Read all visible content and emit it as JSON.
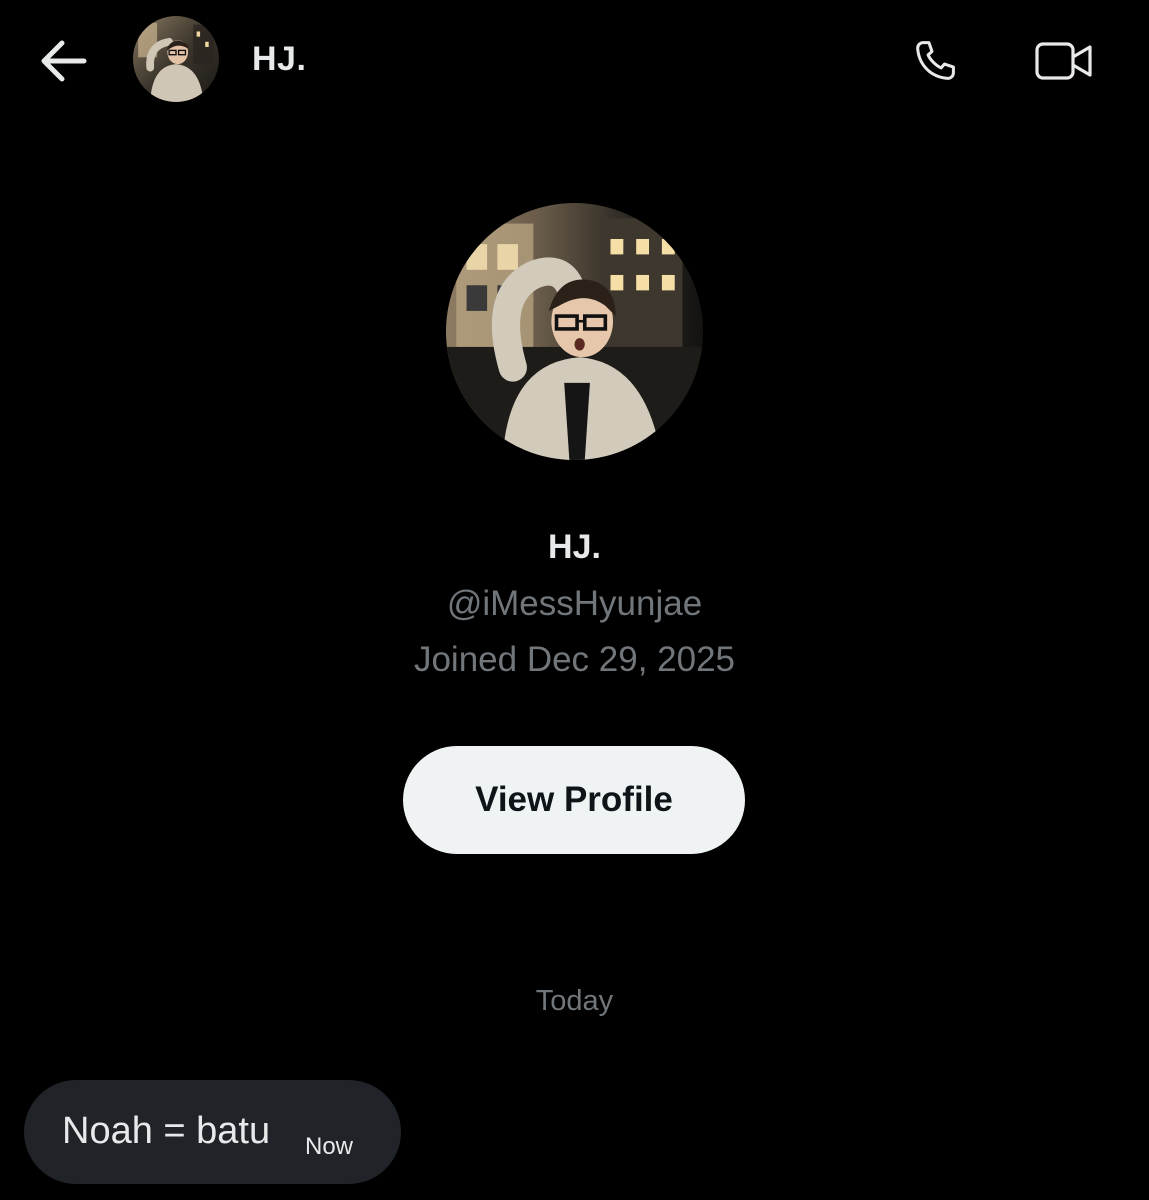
{
  "colors": {
    "background": "#000000",
    "primary_text": "#e7e9ea",
    "secondary_text": "#71767b",
    "button_bg": "#eff3f4",
    "button_text": "#0f1419",
    "bubble_bg": "#202327"
  },
  "header": {
    "back_icon": "arrow-left-icon",
    "name": "HJ.",
    "call_icon": "phone-icon",
    "video_icon": "video-camera-icon"
  },
  "profile": {
    "name": "HJ.",
    "handle": "@iMessHyunjae",
    "joined": "Joined Dec 29, 2025",
    "view_profile_label": "View Profile"
  },
  "conversation": {
    "day_label": "Today",
    "messages": [
      {
        "text": "Noah = batu",
        "time": "Now"
      }
    ]
  }
}
